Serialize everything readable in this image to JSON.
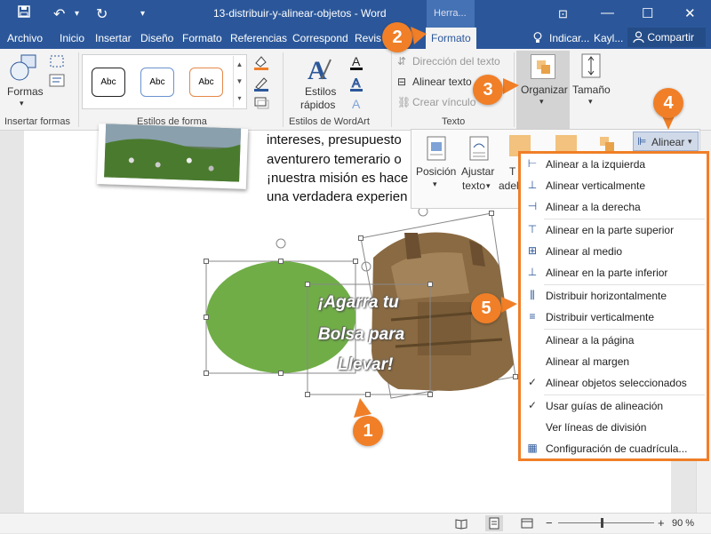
{
  "window": {
    "doc_title": "13-distribuir-y-alinear-objetos - Word",
    "context_tab": "Herra...",
    "undo_icon": "↶",
    "redo_icon": "↻",
    "dropdown_icon": "▾",
    "minimize_icon": "—",
    "maximize_icon": "☐",
    "close_icon": "✕",
    "ribbon_options_icon": "⊡"
  },
  "tabs": [
    "Archivo",
    "Inicio",
    "Insertar",
    "Diseño",
    "Formato",
    "Referencias",
    "Correspond",
    "Revis",
    "Formato"
  ],
  "tabs_right": {
    "tell_me": "Indicar...",
    "user": "Kayl...",
    "share": "Compartir"
  },
  "ribbon": {
    "formas": "Formas",
    "insertar_formas": "Insertar formas",
    "style_sample": "Abc",
    "estilos_forma": "Estilos de forma",
    "estilos_rapidos_1": "Estilos",
    "estilos_rapidos_2": "rápidos",
    "estilos_wordart": "Estilos de WordArt",
    "direccion_texto": "Dirección del texto",
    "alinear_texto": "Alinear texto",
    "crear_vinculo": "Crear vínculo",
    "texto": "Texto",
    "organizar": "Organizar",
    "tamano": "Tamaño"
  },
  "arrange": {
    "posicion": "Posición",
    "ajustar_1": "Ajustar",
    "ajustar_2": "texto",
    "traer_1": "T",
    "traer_2": "adel",
    "alinear": "Alinear"
  },
  "document": {
    "lines": [
      "intereses, presupuesto",
      "aventurero temerario o",
      "¡nuestra misión es hace",
      "una verdadera experien"
    ],
    "wordart_lines": [
      "¡Agarra tu",
      "Bolsa para",
      "Llevar!"
    ]
  },
  "menu": {
    "items": [
      {
        "icon": "⊢",
        "label": "Alinear a la izquierda",
        "checked": false
      },
      {
        "icon": "⊥",
        "label": "Alinear verticalmente",
        "checked": false
      },
      {
        "icon": "⊣",
        "label": "Alinear a la derecha",
        "checked": false
      },
      {
        "icon": "⊤",
        "label": "Alinear en la parte superior",
        "checked": false
      },
      {
        "icon": "⊞",
        "label": "Alinear al medio",
        "checked": false
      },
      {
        "icon": "⊥",
        "label": "Alinear en la parte inferior",
        "checked": false
      },
      {
        "icon": "⫼",
        "label": "Distribuir horizontalmente",
        "checked": false
      },
      {
        "icon": "≡",
        "label": "Distribuir verticalmente",
        "checked": false
      },
      {
        "icon": "",
        "label": "Alinear a la página",
        "checked": false
      },
      {
        "icon": "",
        "label": "Alinear al margen",
        "checked": false
      },
      {
        "icon": "✓",
        "label": "Alinear objetos seleccionados",
        "checked": true
      },
      {
        "icon": "✓",
        "label": "Usar guías de alineación",
        "checked": true
      },
      {
        "icon": "",
        "label": "Ver líneas de división",
        "checked": false
      },
      {
        "icon": "▦",
        "label": "Configuración de cuadrícula...",
        "checked": false
      }
    ]
  },
  "callouts": [
    "1",
    "2",
    "3",
    "4",
    "5"
  ],
  "status": {
    "zoom": "90 %",
    "zoom_minus": "−",
    "zoom_plus": "+"
  },
  "colors": {
    "word_blue": "#2b579a",
    "accent_orange": "#f07f28",
    "ellipse_green": "#70ad47"
  }
}
